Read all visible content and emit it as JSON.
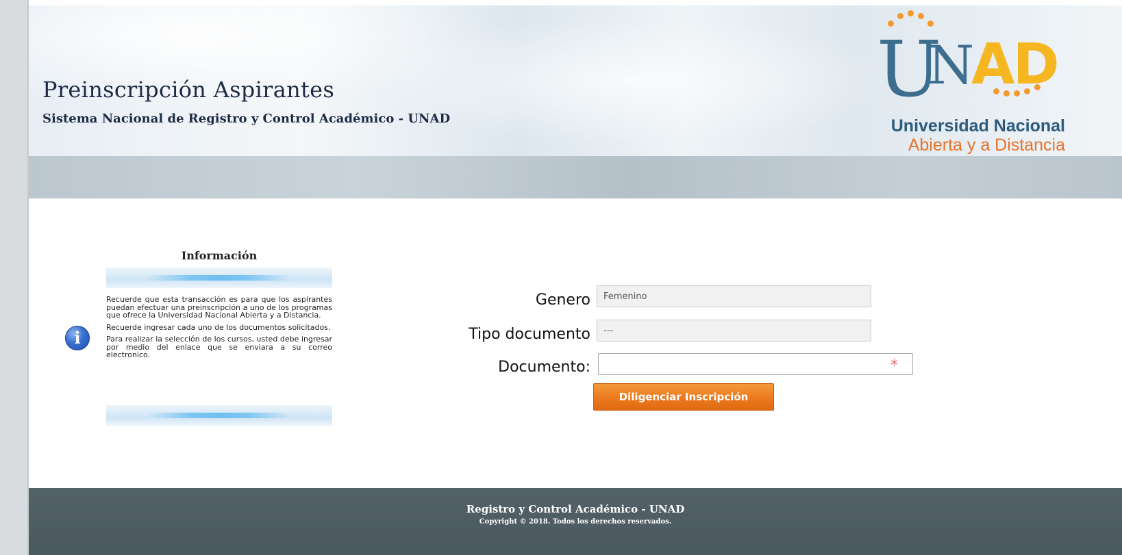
{
  "header": {
    "title": "Preinscripción Aspirantes",
    "subtitle": "Sistema Nacional de Registro y Control Académico - UNAD",
    "logo": {
      "acronym_u": "U",
      "acronym_n": "N",
      "acronym_ad": "AD",
      "line1": "Universidad Nacional",
      "line2": "Abierta y a Distancia",
      "brand_blue": "#3d6e90",
      "brand_yellow": "#f5b621",
      "brand_orange": "#e7722a"
    }
  },
  "info_panel": {
    "title": "Información",
    "icon": "info-icon",
    "paragraphs": [
      "Recuerde que esta transacción es para que los aspirantes puedan efectuar una preinscripción a uno de los programas que ofrece la Universidad Nacional Abierta y a Distancia.",
      "Recuerde ingresar cada uno de los documentos solicitados.",
      "Para realizar la selección de los cursos, usted debe ingresar por medio del enlace que se enviara a su correo electronico."
    ]
  },
  "form": {
    "genero_label": "Genero",
    "genero_value": "Femenino",
    "tipo_documento_label": "Tipo documento",
    "tipo_documento_value": "---",
    "documento_label": "Documento:",
    "documento_value": "",
    "required_mark": "*",
    "submit_label": "Diligenciar Inscripción",
    "accent_color": "#ec7a1e"
  },
  "footer": {
    "title": "Registro y Control Académico - UNAD",
    "copyright": "Copyright © 2018. Todos los derechos reservados."
  }
}
